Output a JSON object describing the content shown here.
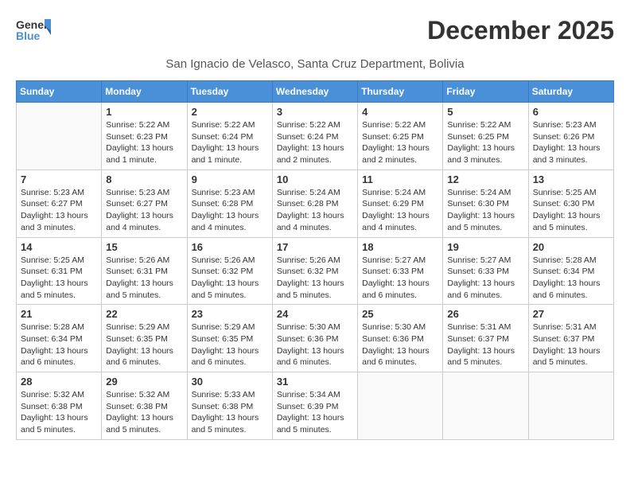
{
  "logo": {
    "line1": "General",
    "line2": "Blue"
  },
  "title": "December 2025",
  "subtitle": "San Ignacio de Velasco, Santa Cruz Department, Bolivia",
  "days_of_week": [
    "Sunday",
    "Monday",
    "Tuesday",
    "Wednesday",
    "Thursday",
    "Friday",
    "Saturday"
  ],
  "weeks": [
    [
      {
        "day": "",
        "info": ""
      },
      {
        "day": "1",
        "info": "Sunrise: 5:22 AM\nSunset: 6:23 PM\nDaylight: 13 hours\nand 1 minute."
      },
      {
        "day": "2",
        "info": "Sunrise: 5:22 AM\nSunset: 6:24 PM\nDaylight: 13 hours\nand 1 minute."
      },
      {
        "day": "3",
        "info": "Sunrise: 5:22 AM\nSunset: 6:24 PM\nDaylight: 13 hours\nand 2 minutes."
      },
      {
        "day": "4",
        "info": "Sunrise: 5:22 AM\nSunset: 6:25 PM\nDaylight: 13 hours\nand 2 minutes."
      },
      {
        "day": "5",
        "info": "Sunrise: 5:22 AM\nSunset: 6:25 PM\nDaylight: 13 hours\nand 3 minutes."
      },
      {
        "day": "6",
        "info": "Sunrise: 5:23 AM\nSunset: 6:26 PM\nDaylight: 13 hours\nand 3 minutes."
      }
    ],
    [
      {
        "day": "7",
        "info": "Sunrise: 5:23 AM\nSunset: 6:27 PM\nDaylight: 13 hours\nand 3 minutes."
      },
      {
        "day": "8",
        "info": "Sunrise: 5:23 AM\nSunset: 6:27 PM\nDaylight: 13 hours\nand 4 minutes."
      },
      {
        "day": "9",
        "info": "Sunrise: 5:23 AM\nSunset: 6:28 PM\nDaylight: 13 hours\nand 4 minutes."
      },
      {
        "day": "10",
        "info": "Sunrise: 5:24 AM\nSunset: 6:28 PM\nDaylight: 13 hours\nand 4 minutes."
      },
      {
        "day": "11",
        "info": "Sunrise: 5:24 AM\nSunset: 6:29 PM\nDaylight: 13 hours\nand 4 minutes."
      },
      {
        "day": "12",
        "info": "Sunrise: 5:24 AM\nSunset: 6:30 PM\nDaylight: 13 hours\nand 5 minutes."
      },
      {
        "day": "13",
        "info": "Sunrise: 5:25 AM\nSunset: 6:30 PM\nDaylight: 13 hours\nand 5 minutes."
      }
    ],
    [
      {
        "day": "14",
        "info": "Sunrise: 5:25 AM\nSunset: 6:31 PM\nDaylight: 13 hours\nand 5 minutes."
      },
      {
        "day": "15",
        "info": "Sunrise: 5:26 AM\nSunset: 6:31 PM\nDaylight: 13 hours\nand 5 minutes."
      },
      {
        "day": "16",
        "info": "Sunrise: 5:26 AM\nSunset: 6:32 PM\nDaylight: 13 hours\nand 5 minutes."
      },
      {
        "day": "17",
        "info": "Sunrise: 5:26 AM\nSunset: 6:32 PM\nDaylight: 13 hours\nand 5 minutes."
      },
      {
        "day": "18",
        "info": "Sunrise: 5:27 AM\nSunset: 6:33 PM\nDaylight: 13 hours\nand 6 minutes."
      },
      {
        "day": "19",
        "info": "Sunrise: 5:27 AM\nSunset: 6:33 PM\nDaylight: 13 hours\nand 6 minutes."
      },
      {
        "day": "20",
        "info": "Sunrise: 5:28 AM\nSunset: 6:34 PM\nDaylight: 13 hours\nand 6 minutes."
      }
    ],
    [
      {
        "day": "21",
        "info": "Sunrise: 5:28 AM\nSunset: 6:34 PM\nDaylight: 13 hours\nand 6 minutes."
      },
      {
        "day": "22",
        "info": "Sunrise: 5:29 AM\nSunset: 6:35 PM\nDaylight: 13 hours\nand 6 minutes."
      },
      {
        "day": "23",
        "info": "Sunrise: 5:29 AM\nSunset: 6:35 PM\nDaylight: 13 hours\nand 6 minutes."
      },
      {
        "day": "24",
        "info": "Sunrise: 5:30 AM\nSunset: 6:36 PM\nDaylight: 13 hours\nand 6 minutes."
      },
      {
        "day": "25",
        "info": "Sunrise: 5:30 AM\nSunset: 6:36 PM\nDaylight: 13 hours\nand 6 minutes."
      },
      {
        "day": "26",
        "info": "Sunrise: 5:31 AM\nSunset: 6:37 PM\nDaylight: 13 hours\nand 5 minutes."
      },
      {
        "day": "27",
        "info": "Sunrise: 5:31 AM\nSunset: 6:37 PM\nDaylight: 13 hours\nand 5 minutes."
      }
    ],
    [
      {
        "day": "28",
        "info": "Sunrise: 5:32 AM\nSunset: 6:38 PM\nDaylight: 13 hours\nand 5 minutes."
      },
      {
        "day": "29",
        "info": "Sunrise: 5:32 AM\nSunset: 6:38 PM\nDaylight: 13 hours\nand 5 minutes."
      },
      {
        "day": "30",
        "info": "Sunrise: 5:33 AM\nSunset: 6:38 PM\nDaylight: 13 hours\nand 5 minutes."
      },
      {
        "day": "31",
        "info": "Sunrise: 5:34 AM\nSunset: 6:39 PM\nDaylight: 13 hours\nand 5 minutes."
      },
      {
        "day": "",
        "info": ""
      },
      {
        "day": "",
        "info": ""
      },
      {
        "day": "",
        "info": ""
      }
    ]
  ]
}
